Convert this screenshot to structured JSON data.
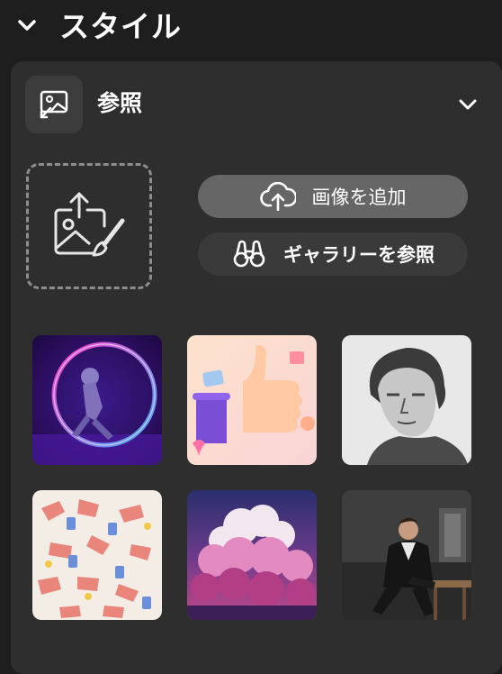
{
  "section": {
    "title": "スタイル",
    "chevron_icon": "chevron-down-icon"
  },
  "reference": {
    "label": "参照",
    "icon": "image-reference-icon",
    "chevron_icon": "chevron-down-icon"
  },
  "upload": {
    "icon": "image-upload-icon",
    "add_image_label": "画像を追加",
    "add_image_icon": "cloud-upload-icon",
    "gallery_label": "ギャラリーを参照",
    "gallery_icon": "binoculars-icon"
  },
  "gallery": {
    "thumbnails": [
      {
        "name": "neon-ring-astronaut"
      },
      {
        "name": "3d-thumbs-up"
      },
      {
        "name": "engraved-portrait"
      },
      {
        "name": "hands-pattern"
      },
      {
        "name": "pink-clouds"
      },
      {
        "name": "man-in-suit"
      }
    ]
  },
  "colors": {
    "background": "#1e1e1e",
    "panel": "#2e2e2e",
    "button_primary": "#666666",
    "button_secondary": "#3a3a3a"
  }
}
